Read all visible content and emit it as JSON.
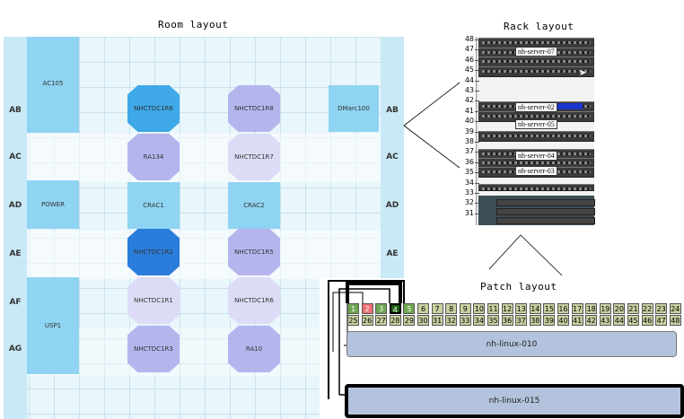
{
  "titles": {
    "room": "Room layout",
    "rack": "Rack layout",
    "patch": "Patch layout"
  },
  "room": {
    "rows": [
      "AB",
      "AC",
      "AD",
      "AE",
      "AF",
      "AG"
    ],
    "cells": {
      "ac105": "AC105",
      "power": "POWER",
      "usp1": "USP1",
      "r6": "NHCTDC1R6",
      "r8": "NHCTDC1R8",
      "dmarc": "DMarc100",
      "ra134": "RA134",
      "r7": "NHCTDC1R7",
      "crac1": "CRAC1",
      "crac2": "CRAC2",
      "r2": "NHCTDC1R2",
      "r5": "NHCTDC1R5",
      "r1": "NHCTDC1R1",
      "r6b": "NHCTDC1R6",
      "r3": "NHCTDC1R3",
      "ra10": "RA10"
    },
    "colors": {
      "light_blue": "#8fd4f2",
      "lavender": "#b5b5ee",
      "pale_lavender": "#dddcf6",
      "bright_blue": "#52b9ef",
      "deep_blue": "#2b7ddc"
    }
  },
  "rack": {
    "units": [
      "48",
      "47",
      "46",
      "45",
      "44",
      "43",
      "42",
      "41",
      "40",
      "39",
      "38",
      "37",
      "36",
      "35",
      "34",
      "33",
      "32",
      "31"
    ],
    "servers": {
      "s07": "nh-server-07",
      "s02": "nh-server-02",
      "s05": "nh-server-05",
      "s04": "nh-server-04",
      "s03": "nh-server-03"
    }
  },
  "patch": {
    "ports_top": [
      "1",
      "2",
      "3",
      "4",
      "5",
      "6",
      "7",
      "8",
      "9",
      "10",
      "11",
      "12",
      "13",
      "14",
      "15",
      "16",
      "17",
      "18",
      "19",
      "20",
      "21",
      "22",
      "23",
      "24"
    ],
    "ports_bottom": [
      "25",
      "26",
      "27",
      "28",
      "29",
      "30",
      "31",
      "32",
      "33",
      "34",
      "35",
      "36",
      "37",
      "38",
      "39",
      "40",
      "41",
      "42",
      "43",
      "44",
      "45",
      "46",
      "47",
      "48"
    ],
    "device1": "nh-linux-010",
    "device2": "nh-linux-015"
  }
}
